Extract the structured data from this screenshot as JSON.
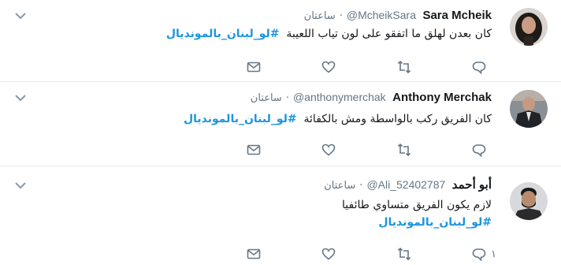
{
  "tweets": [
    {
      "name": "Sara Mcheik",
      "handle": "@McheikSara",
      "time": "ساعتان",
      "text": "كان بعدن لهلق ما اتفقو على لون تياب اللعيبة",
      "hashtag": "#لو_لبنان_بالمونديال",
      "reply_count": "",
      "avatar": "woman-avatar"
    },
    {
      "name": "Anthony Merchak",
      "handle": "@anthonymerchak",
      "time": "ساعتان",
      "text": "كان الفريق ركب بالواسطة ومش بالكفائة",
      "hashtag": "#لو_لبنان_بالمونديال",
      "reply_count": "",
      "avatar": "man-suit-avatar"
    },
    {
      "name": "أبو أحمد",
      "handle": "@Ali_52402787",
      "time": "ساعتان",
      "text": "لازم يكون الفريق متساوي طائفيا",
      "hashtag": "#لو_لبنان_بالمونديال",
      "reply_count": "١",
      "avatar": "bearded-man-avatar"
    }
  ],
  "colors": {
    "hashtag": "#1b95e0",
    "muted": "#657786",
    "border": "#e6ecf0"
  },
  "icons": [
    "chevron-down-icon",
    "reply-icon",
    "retweet-icon",
    "like-icon",
    "message-icon"
  ]
}
